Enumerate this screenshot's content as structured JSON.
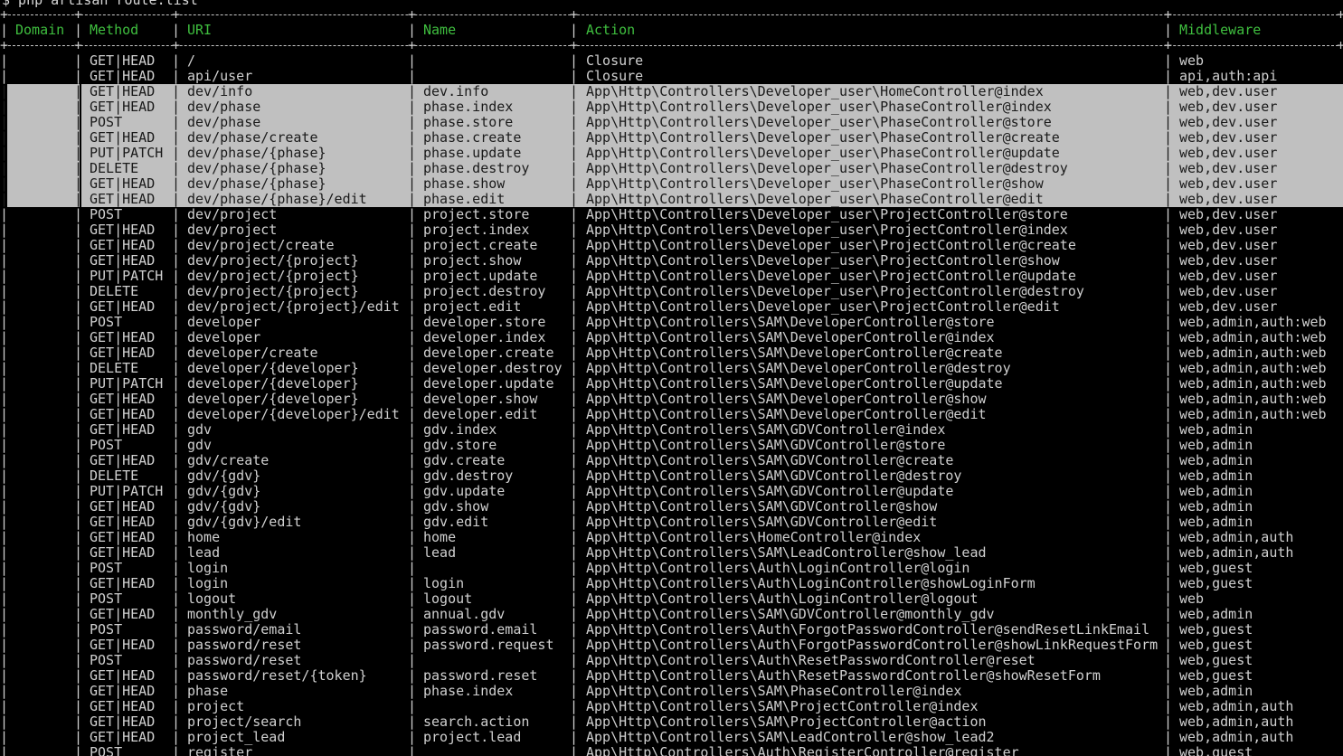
{
  "terminal": {
    "command": "$ php artisan route:list",
    "header_color": "#3fbf3f",
    "highlight_color": "#c0c0c0",
    "columns": [
      "Domain",
      "Method",
      "URI",
      "Name",
      "Action",
      "Middleware"
    ],
    "rows": [
      {
        "method": "GET|HEAD",
        "uri": "/",
        "name": "",
        "action": "Closure",
        "middleware": "web",
        "hl": false
      },
      {
        "method": "GET|HEAD",
        "uri": "api/user",
        "name": "",
        "action": "Closure",
        "middleware": "api,auth:api",
        "hl": false
      },
      {
        "method": "GET|HEAD",
        "uri": "dev/info",
        "name": "dev.info",
        "action": "App\\Http\\Controllers\\Developer_user\\HomeController@index",
        "middleware": "web,dev.user",
        "hl": true
      },
      {
        "method": "GET|HEAD",
        "uri": "dev/phase",
        "name": "phase.index",
        "action": "App\\Http\\Controllers\\Developer_user\\PhaseController@index",
        "middleware": "web,dev.user",
        "hl": true
      },
      {
        "method": "POST",
        "uri": "dev/phase",
        "name": "phase.store",
        "action": "App\\Http\\Controllers\\Developer_user\\PhaseController@store",
        "middleware": "web,dev.user",
        "hl": true
      },
      {
        "method": "GET|HEAD",
        "uri": "dev/phase/create",
        "name": "phase.create",
        "action": "App\\Http\\Controllers\\Developer_user\\PhaseController@create",
        "middleware": "web,dev.user",
        "hl": true
      },
      {
        "method": "PUT|PATCH",
        "uri": "dev/phase/{phase}",
        "name": "phase.update",
        "action": "App\\Http\\Controllers\\Developer_user\\PhaseController@update",
        "middleware": "web,dev.user",
        "hl": true
      },
      {
        "method": "DELETE",
        "uri": "dev/phase/{phase}",
        "name": "phase.destroy",
        "action": "App\\Http\\Controllers\\Developer_user\\PhaseController@destroy",
        "middleware": "web,dev.user",
        "hl": true
      },
      {
        "method": "GET|HEAD",
        "uri": "dev/phase/{phase}",
        "name": "phase.show",
        "action": "App\\Http\\Controllers\\Developer_user\\PhaseController@show",
        "middleware": "web,dev.user",
        "hl": true
      },
      {
        "method": "GET|HEAD",
        "uri": "dev/phase/{phase}/edit",
        "name": "phase.edit",
        "action": "App\\Http\\Controllers\\Developer_user\\PhaseController@edit",
        "middleware": "web,dev.user",
        "hl": true
      },
      {
        "method": "POST",
        "uri": "dev/project",
        "name": "project.store",
        "action": "App\\Http\\Controllers\\Developer_user\\ProjectController@store",
        "middleware": "web,dev.user",
        "hl": false
      },
      {
        "method": "GET|HEAD",
        "uri": "dev/project",
        "name": "project.index",
        "action": "App\\Http\\Controllers\\Developer_user\\ProjectController@index",
        "middleware": "web,dev.user",
        "hl": false
      },
      {
        "method": "GET|HEAD",
        "uri": "dev/project/create",
        "name": "project.create",
        "action": "App\\Http\\Controllers\\Developer_user\\ProjectController@create",
        "middleware": "web,dev.user",
        "hl": false
      },
      {
        "method": "GET|HEAD",
        "uri": "dev/project/{project}",
        "name": "project.show",
        "action": "App\\Http\\Controllers\\Developer_user\\ProjectController@show",
        "middleware": "web,dev.user",
        "hl": false
      },
      {
        "method": "PUT|PATCH",
        "uri": "dev/project/{project}",
        "name": "project.update",
        "action": "App\\Http\\Controllers\\Developer_user\\ProjectController@update",
        "middleware": "web,dev.user",
        "hl": false
      },
      {
        "method": "DELETE",
        "uri": "dev/project/{project}",
        "name": "project.destroy",
        "action": "App\\Http\\Controllers\\Developer_user\\ProjectController@destroy",
        "middleware": "web,dev.user",
        "hl": false
      },
      {
        "method": "GET|HEAD",
        "uri": "dev/project/{project}/edit",
        "name": "project.edit",
        "action": "App\\Http\\Controllers\\Developer_user\\ProjectController@edit",
        "middleware": "web,dev.user",
        "hl": false
      },
      {
        "method": "POST",
        "uri": "developer",
        "name": "developer.store",
        "action": "App\\Http\\Controllers\\SAM\\DeveloperController@store",
        "middleware": "web,admin,auth:web",
        "hl": false
      },
      {
        "method": "GET|HEAD",
        "uri": "developer",
        "name": "developer.index",
        "action": "App\\Http\\Controllers\\SAM\\DeveloperController@index",
        "middleware": "web,admin,auth:web",
        "hl": false
      },
      {
        "method": "GET|HEAD",
        "uri": "developer/create",
        "name": "developer.create",
        "action": "App\\Http\\Controllers\\SAM\\DeveloperController@create",
        "middleware": "web,admin,auth:web",
        "hl": false
      },
      {
        "method": "DELETE",
        "uri": "developer/{developer}",
        "name": "developer.destroy",
        "action": "App\\Http\\Controllers\\SAM\\DeveloperController@destroy",
        "middleware": "web,admin,auth:web",
        "hl": false
      },
      {
        "method": "PUT|PATCH",
        "uri": "developer/{developer}",
        "name": "developer.update",
        "action": "App\\Http\\Controllers\\SAM\\DeveloperController@update",
        "middleware": "web,admin,auth:web",
        "hl": false
      },
      {
        "method": "GET|HEAD",
        "uri": "developer/{developer}",
        "name": "developer.show",
        "action": "App\\Http\\Controllers\\SAM\\DeveloperController@show",
        "middleware": "web,admin,auth:web",
        "hl": false
      },
      {
        "method": "GET|HEAD",
        "uri": "developer/{developer}/edit",
        "name": "developer.edit",
        "action": "App\\Http\\Controllers\\SAM\\DeveloperController@edit",
        "middleware": "web,admin,auth:web",
        "hl": false
      },
      {
        "method": "GET|HEAD",
        "uri": "gdv",
        "name": "gdv.index",
        "action": "App\\Http\\Controllers\\SAM\\GDVController@index",
        "middleware": "web,admin",
        "hl": false
      },
      {
        "method": "POST",
        "uri": "gdv",
        "name": "gdv.store",
        "action": "App\\Http\\Controllers\\SAM\\GDVController@store",
        "middleware": "web,admin",
        "hl": false
      },
      {
        "method": "GET|HEAD",
        "uri": "gdv/create",
        "name": "gdv.create",
        "action": "App\\Http\\Controllers\\SAM\\GDVController@create",
        "middleware": "web,admin",
        "hl": false
      },
      {
        "method": "DELETE",
        "uri": "gdv/{gdv}",
        "name": "gdv.destroy",
        "action": "App\\Http\\Controllers\\SAM\\GDVController@destroy",
        "middleware": "web,admin",
        "hl": false
      },
      {
        "method": "PUT|PATCH",
        "uri": "gdv/{gdv}",
        "name": "gdv.update",
        "action": "App\\Http\\Controllers\\SAM\\GDVController@update",
        "middleware": "web,admin",
        "hl": false
      },
      {
        "method": "GET|HEAD",
        "uri": "gdv/{gdv}",
        "name": "gdv.show",
        "action": "App\\Http\\Controllers\\SAM\\GDVController@show",
        "middleware": "web,admin",
        "hl": false
      },
      {
        "method": "GET|HEAD",
        "uri": "gdv/{gdv}/edit",
        "name": "gdv.edit",
        "action": "App\\Http\\Controllers\\SAM\\GDVController@edit",
        "middleware": "web,admin",
        "hl": false
      },
      {
        "method": "GET|HEAD",
        "uri": "home",
        "name": "home",
        "action": "App\\Http\\Controllers\\HomeController@index",
        "middleware": "web,admin,auth",
        "hl": false
      },
      {
        "method": "GET|HEAD",
        "uri": "lead",
        "name": "lead",
        "action": "App\\Http\\Controllers\\SAM\\LeadController@show_lead",
        "middleware": "web,admin,auth",
        "hl": false
      },
      {
        "method": "POST",
        "uri": "login",
        "name": "",
        "action": "App\\Http\\Controllers\\Auth\\LoginController@login",
        "middleware": "web,guest",
        "hl": false
      },
      {
        "method": "GET|HEAD",
        "uri": "login",
        "name": "login",
        "action": "App\\Http\\Controllers\\Auth\\LoginController@showLoginForm",
        "middleware": "web,guest",
        "hl": false
      },
      {
        "method": "POST",
        "uri": "logout",
        "name": "logout",
        "action": "App\\Http\\Controllers\\Auth\\LoginController@logout",
        "middleware": "web",
        "hl": false
      },
      {
        "method": "GET|HEAD",
        "uri": "monthly_gdv",
        "name": "annual.gdv",
        "action": "App\\Http\\Controllers\\SAM\\GDVController@monthly_gdv",
        "middleware": "web,admin",
        "hl": false
      },
      {
        "method": "POST",
        "uri": "password/email",
        "name": "password.email",
        "action": "App\\Http\\Controllers\\Auth\\ForgotPasswordController@sendResetLinkEmail",
        "middleware": "web,guest",
        "hl": false
      },
      {
        "method": "GET|HEAD",
        "uri": "password/reset",
        "name": "password.request",
        "action": "App\\Http\\Controllers\\Auth\\ForgotPasswordController@showLinkRequestForm",
        "middleware": "web,guest",
        "hl": false
      },
      {
        "method": "POST",
        "uri": "password/reset",
        "name": "",
        "action": "App\\Http\\Controllers\\Auth\\ResetPasswordController@reset",
        "middleware": "web,guest",
        "hl": false
      },
      {
        "method": "GET|HEAD",
        "uri": "password/reset/{token}",
        "name": "password.reset",
        "action": "App\\Http\\Controllers\\Auth\\ResetPasswordController@showResetForm",
        "middleware": "web,guest",
        "hl": false
      },
      {
        "method": "GET|HEAD",
        "uri": "phase",
        "name": "phase.index",
        "action": "App\\Http\\Controllers\\SAM\\PhaseController@index",
        "middleware": "web,admin",
        "hl": false
      },
      {
        "method": "GET|HEAD",
        "uri": "project",
        "name": "",
        "action": "App\\Http\\Controllers\\SAM\\ProjectController@index",
        "middleware": "web,admin,auth",
        "hl": false
      },
      {
        "method": "GET|HEAD",
        "uri": "project/search",
        "name": "search.action",
        "action": "App\\Http\\Controllers\\SAM\\ProjectController@action",
        "middleware": "web,admin,auth",
        "hl": false
      },
      {
        "method": "GET|HEAD",
        "uri": "project_lead",
        "name": "project.lead",
        "action": "App\\Http\\Controllers\\SAM\\LeadController@show_lead2",
        "middleware": "web,admin,auth",
        "hl": false
      },
      {
        "method": "POST",
        "uri": "register",
        "name": "",
        "action": "App\\Http\\Controllers\\Auth\\RegisterController@register",
        "middleware": "web,guest",
        "hl": false
      }
    ]
  }
}
